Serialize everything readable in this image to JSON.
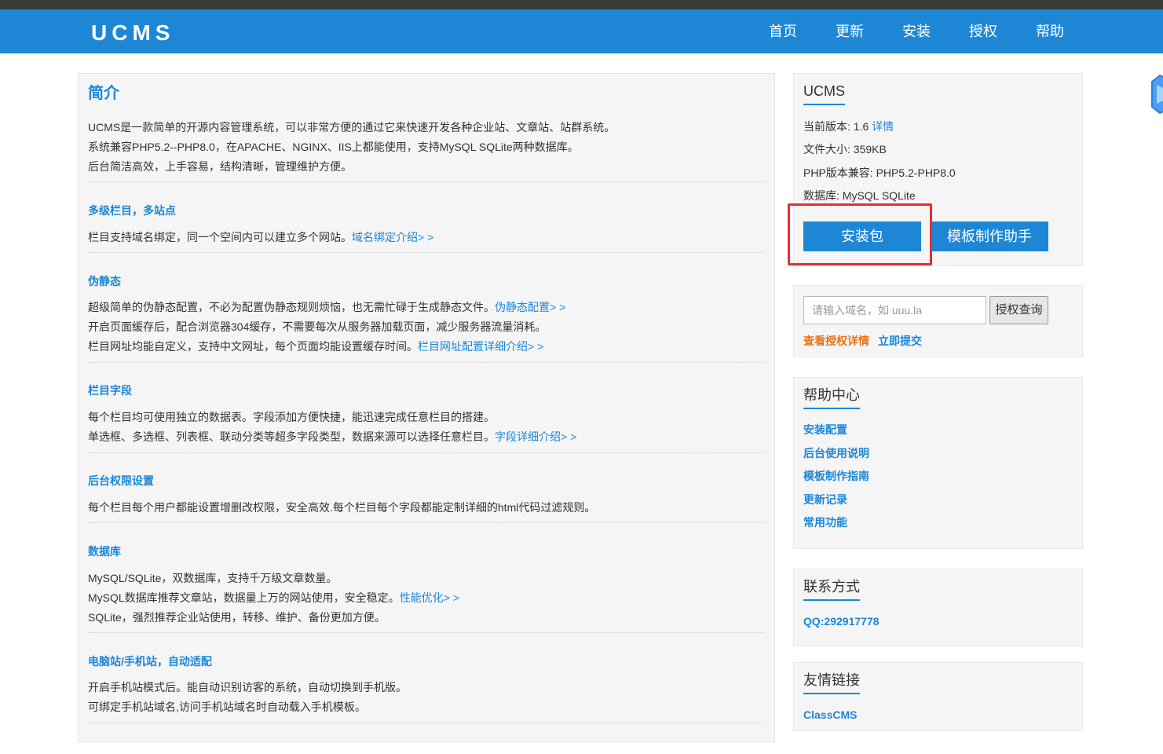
{
  "header": {
    "logo": "UCMS",
    "nav": [
      "首页",
      "更新",
      "安装",
      "授权",
      "帮助"
    ]
  },
  "intro": {
    "title": "简介",
    "lines": [
      "UCMS是一款简单的开源内容管理系统，可以非常方便的通过它来快速开发各种企业站、文章站、站群系统。",
      "系统兼容PHP5.2--PHP8.0，在APACHE、NGINX、IIS上都能使用，支持MySQL SQLite两种数据库。",
      "后台简洁高效，上手容易，结构清晰，管理维护方便。"
    ]
  },
  "sections": [
    {
      "title": "多级栏目，多站点",
      "lines": [
        {
          "text": "栏目支持域名绑定，同一个空间内可以建立多个网站。",
          "link": "域名绑定介绍> >"
        }
      ]
    },
    {
      "title": "伪静态",
      "lines": [
        {
          "text": "超级简单的伪静态配置，不必为配置伪静态规则烦恼，也无需忙碌于生成静态文件。",
          "link": "伪静态配置> >"
        },
        {
          "text": "开启页面缓存后，配合浏览器304缓存，不需要每次从服务器加载页面，减少服务器流量消耗。",
          "link": ""
        },
        {
          "text": "栏目网址均能自定义，支持中文网址，每个页面均能设置缓存时间。",
          "link": "栏目网址配置详细介绍> >"
        }
      ]
    },
    {
      "title": "栏目字段",
      "lines": [
        {
          "text": "每个栏目均可使用独立的数据表。字段添加方便快捷，能迅速完成任意栏目的搭建。",
          "link": ""
        },
        {
          "text": "单选框、多选框、列表框、联动分类等超多字段类型，数据来源可以选择任意栏目。",
          "link": "字段详细介绍> >"
        }
      ]
    },
    {
      "title": "后台权限设置",
      "lines": [
        {
          "text": "每个栏目每个用户都能设置增删改权限，安全高效.每个栏目每个字段都能定制详细的html代码过滤规则。",
          "link": ""
        }
      ]
    },
    {
      "title": "数据库",
      "lines": [
        {
          "text": "MySQL/SQLite，双数据库，支持千万级文章数量。",
          "link": ""
        },
        {
          "text": "MySQL数据库推荐文章站，数据量上万的网站使用，安全稳定。",
          "link": "性能优化> >"
        },
        {
          "text": "SQLite，强烈推荐企业站使用，转移、维护、备份更加方便。",
          "link": ""
        }
      ]
    },
    {
      "title": "电脑站/手机站，自动适配",
      "lines": [
        {
          "text": "开启手机站模式后。能自动识别访客的系统，自动切换到手机版。",
          "link": ""
        },
        {
          "text": "可绑定手机站域名,访问手机站域名时自动载入手机模板。",
          "link": ""
        }
      ]
    }
  ],
  "sidebar": {
    "info": {
      "title": "UCMS",
      "version_label": "当前版本: 1.6",
      "version_link": "详情",
      "size": "文件大小: 359KB",
      "php": "PHP版本兼容: PHP5.2-PHP8.0",
      "db": "数据库: MySQL SQLite",
      "install_button": "安装包",
      "template_button": "模板制作助手"
    },
    "license": {
      "placeholder": "请输入域名，如 uuu.la",
      "query_button": "授权查询",
      "detail_link": "查看授权详情",
      "submit_link": "立即提交"
    },
    "help": {
      "title": "帮助中心",
      "links": [
        "安装配置",
        "后台使用说明",
        "模板制作指南",
        "更新记录",
        "常用功能"
      ]
    },
    "contact": {
      "title": "联系方式",
      "qq": "QQ:292917778"
    },
    "friends": {
      "title": "友情链接",
      "links": [
        "ClassCMS"
      ]
    }
  },
  "colors": {
    "brand_blue": "#1d87d6",
    "highlight_red": "#e42f2f",
    "orange_link": "#e8731a"
  }
}
